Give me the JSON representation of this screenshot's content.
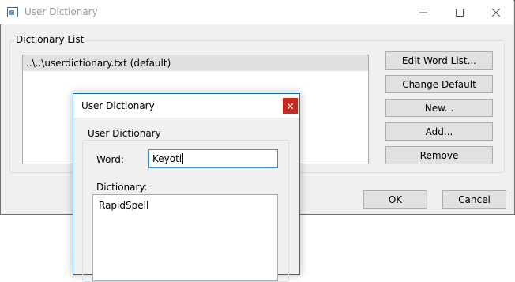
{
  "main_window": {
    "title": "User Dictionary",
    "dictionary_list_label": "Dictionary List",
    "list_items": [
      "..\\..\\userdictionary.txt (default)"
    ],
    "buttons": {
      "edit_word_list": "Edit Word List...",
      "change_default": "Change Default",
      "new": "New...",
      "add": "Add...",
      "remove": "Remove"
    },
    "ok": "OK",
    "cancel": "Cancel"
  },
  "dialog": {
    "title": "User Dictionary",
    "group_label": "User Dictionary",
    "word_label": "Word:",
    "word_value": "Keyoti",
    "dictionary_label": "Dictionary:",
    "dictionary_value": "RapidSpell"
  },
  "icons": {
    "app": "dictionary-window-icon",
    "minimize": "minimize-icon",
    "maximize": "maximize-icon",
    "close": "close-icon",
    "dialog_close": "close-icon"
  },
  "colors": {
    "window_bg": "#f0f0f0",
    "dialog_close_bg": "#c42b1c",
    "focus_border": "#3c8fd7"
  }
}
